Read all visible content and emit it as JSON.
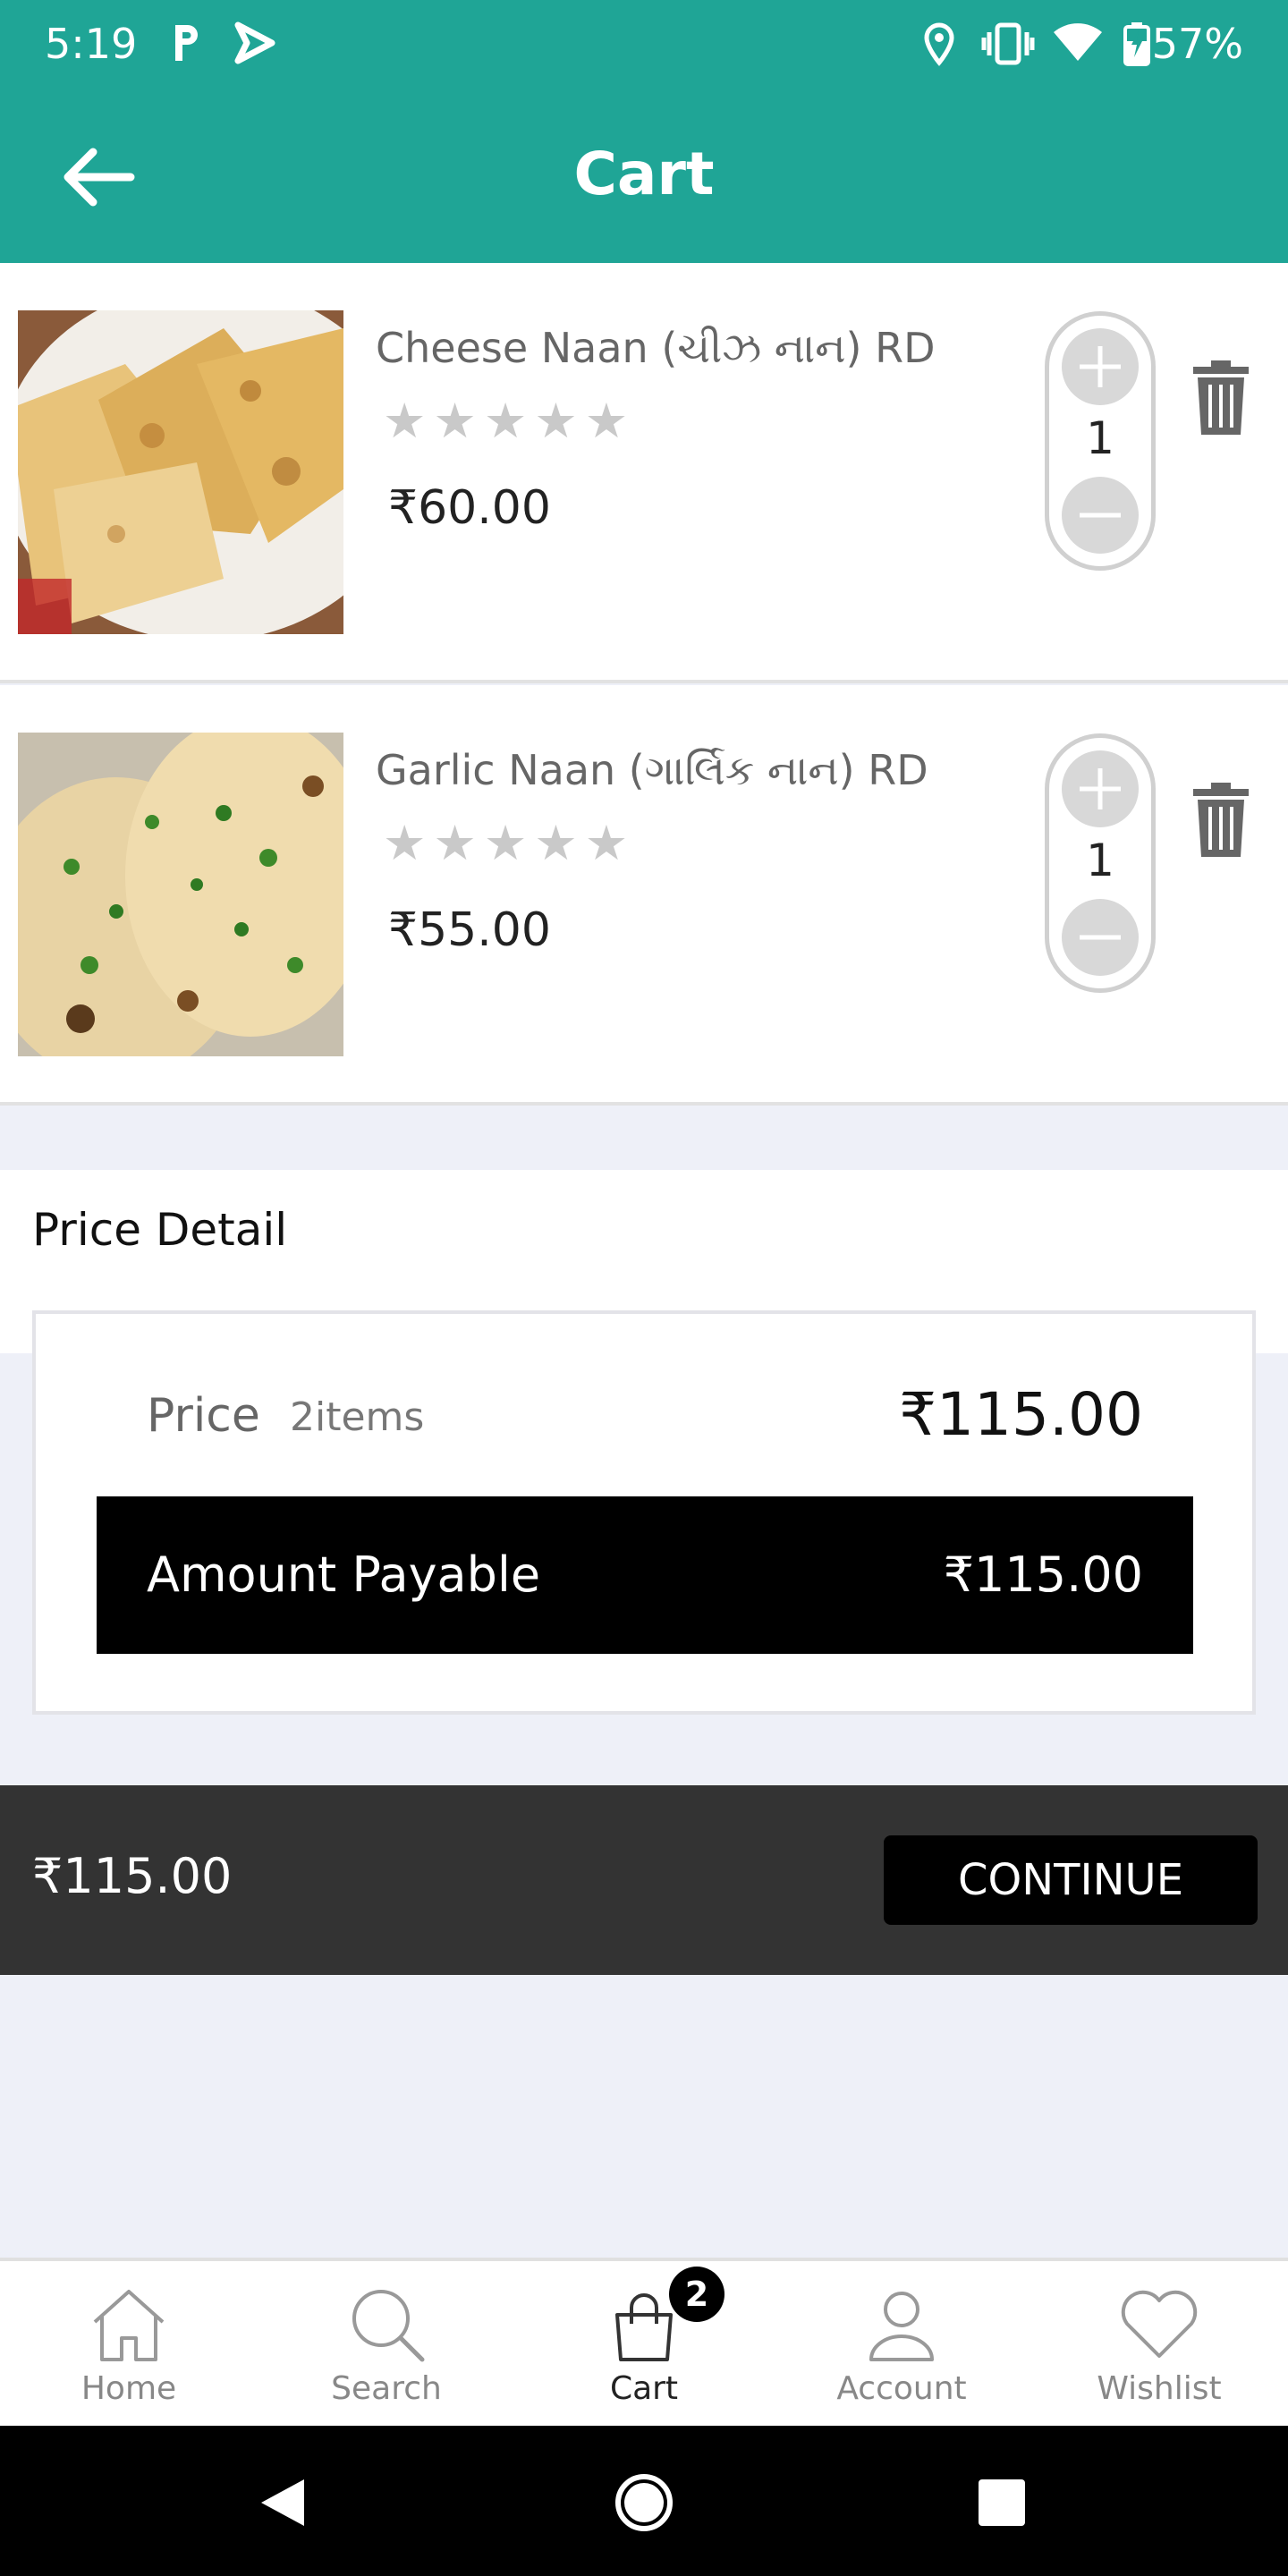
{
  "status_bar": {
    "time": "5:19",
    "battery": "57%"
  },
  "app_bar": {
    "title": "Cart"
  },
  "cart_items": [
    {
      "name": "Cheese Naan (ચીઝ નાન) RD",
      "price": "₹60.00",
      "quantity": "1",
      "rating": 0
    },
    {
      "name": "Garlic Naan (ગાર્લિક નાન) RD",
      "price": "₹55.00",
      "quantity": "1",
      "rating": 0
    }
  ],
  "price_detail": {
    "heading": "Price Detail",
    "price_label": "Price",
    "item_count": "2items",
    "price_value": "₹115.00",
    "payable_label": "Amount Payable",
    "payable_value": "₹115.00"
  },
  "checkout": {
    "total": "₹115.00",
    "continue_label": "CONTINUE"
  },
  "bottom_nav": {
    "items": [
      {
        "label": "Home",
        "icon": "home-icon"
      },
      {
        "label": "Search",
        "icon": "search-icon"
      },
      {
        "label": "Cart",
        "icon": "cart-icon",
        "badge": "2"
      },
      {
        "label": "Account",
        "icon": "account-icon"
      },
      {
        "label": "Wishlist",
        "icon": "heart-icon"
      }
    ],
    "active": "Cart"
  },
  "colors": {
    "primary": "#1fa596",
    "dark_bar": "#333333",
    "button": "#000000"
  }
}
